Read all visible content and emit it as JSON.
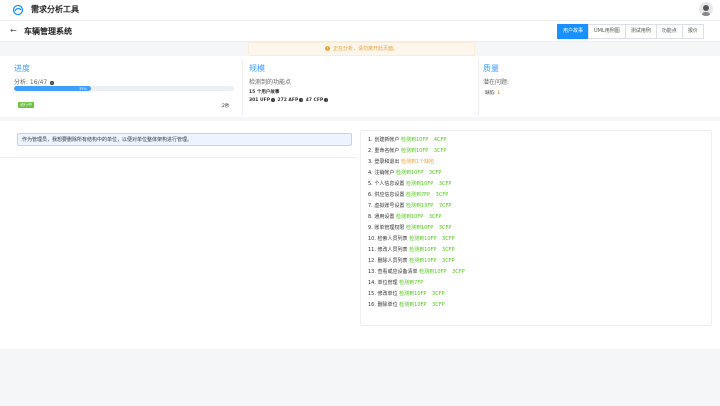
{
  "app": {
    "title": "需求分析工具"
  },
  "project": {
    "back_icon": "←",
    "name": "车辆管理系统"
  },
  "tabs": [
    {
      "label": "用户故事",
      "active": true
    },
    {
      "label": "UML用例图",
      "active": false
    },
    {
      "label": "测试用例",
      "active": false
    },
    {
      "label": "功能点",
      "active": false
    },
    {
      "label": "报价",
      "active": false
    }
  ],
  "alert": {
    "text": "正在分析，请勿离开此页面。"
  },
  "progress": {
    "title": "进度",
    "analysis_label": "分析: 16/47",
    "percent_value": 35,
    "percent_text": "35%",
    "status": "进行中",
    "time": "2秒"
  },
  "scale": {
    "title": "规模",
    "detected_label": "检测到的功能点",
    "user_story_count": "15 个用户故事",
    "ufp": "301 UFP",
    "afp": "272 AFP",
    "cfp": "47 CFP"
  },
  "quality": {
    "title": "质量",
    "issues_label": "潜在问题:",
    "missing_label": "缺陷:",
    "missing_value": "1"
  },
  "user_story": {
    "text": "作为管理员，我想要删除所有结构中的单位，以便对单位整体架构进行管理。"
  },
  "features": [
    {
      "num": "1.",
      "name": "创建新帐户",
      "status": "检测到",
      "fp": "10FP",
      "cfp": "4CFP",
      "tone": "green"
    },
    {
      "num": "2.",
      "name": "重命名帐户",
      "status": "检测到",
      "fp": "10FP",
      "cfp": "3CFP",
      "tone": "green"
    },
    {
      "num": "3.",
      "name": "登录和退出",
      "status": "检测到",
      "fp": "1个缺陷",
      "cfp": "",
      "tone": "orange"
    },
    {
      "num": "4.",
      "name": "注销帐户",
      "status": "检测到",
      "fp": "10FP",
      "cfp": "3CFP",
      "tone": "green"
    },
    {
      "num": "5.",
      "name": "个人信息设置",
      "status": "检测到",
      "fp": "10FP",
      "cfp": "3CFP",
      "tone": "green"
    },
    {
      "num": "6.",
      "name": "供应信息设置",
      "status": "检测到",
      "fp": "7FP",
      "cfp": "3CFP",
      "tone": "green"
    },
    {
      "num": "7.",
      "name": "虚拟账号设置",
      "status": "检测到",
      "fp": "13FP",
      "cfp": "7CFP",
      "tone": "green"
    },
    {
      "num": "8.",
      "name": "通用设置",
      "status": "检测到",
      "fp": "10FP",
      "cfp": "3CFP",
      "tone": "green"
    },
    {
      "num": "9.",
      "name": "账单管理权限",
      "status": "检测到",
      "fp": "10FP",
      "cfp": "3CFP",
      "tone": "green"
    },
    {
      "num": "10.",
      "name": "检索人员列表",
      "status": "检测到",
      "fp": "10FP",
      "cfp": "3CFP",
      "tone": "green"
    },
    {
      "num": "11.",
      "name": "修改人员列表",
      "status": "检测到",
      "fp": "10FP",
      "cfp": "3CFP",
      "tone": "green"
    },
    {
      "num": "12.",
      "name": "删除人员列表",
      "status": "检测到",
      "fp": "10FP",
      "cfp": "3CFP",
      "tone": "green"
    },
    {
      "num": "13.",
      "name": "查看或应设备清单",
      "status": "检测到",
      "fp": "10FP",
      "cfp": "3CFP",
      "tone": "green"
    },
    {
      "num": "14.",
      "name": "单位管理",
      "status": "检测到",
      "fp": "7FP",
      "cfp": "",
      "tone": "green"
    },
    {
      "num": "15.",
      "name": "修改单位",
      "status": "检测到",
      "fp": "10FP",
      "cfp": "3CFP",
      "tone": "green"
    },
    {
      "num": "16.",
      "name": "删除单位",
      "status": "检测到",
      "fp": "10FP",
      "cfp": "3CFP",
      "tone": "green"
    }
  ],
  "colors": {
    "primary": "#1890ff",
    "success": "#52c41a",
    "warning": "#e6a23c"
  }
}
